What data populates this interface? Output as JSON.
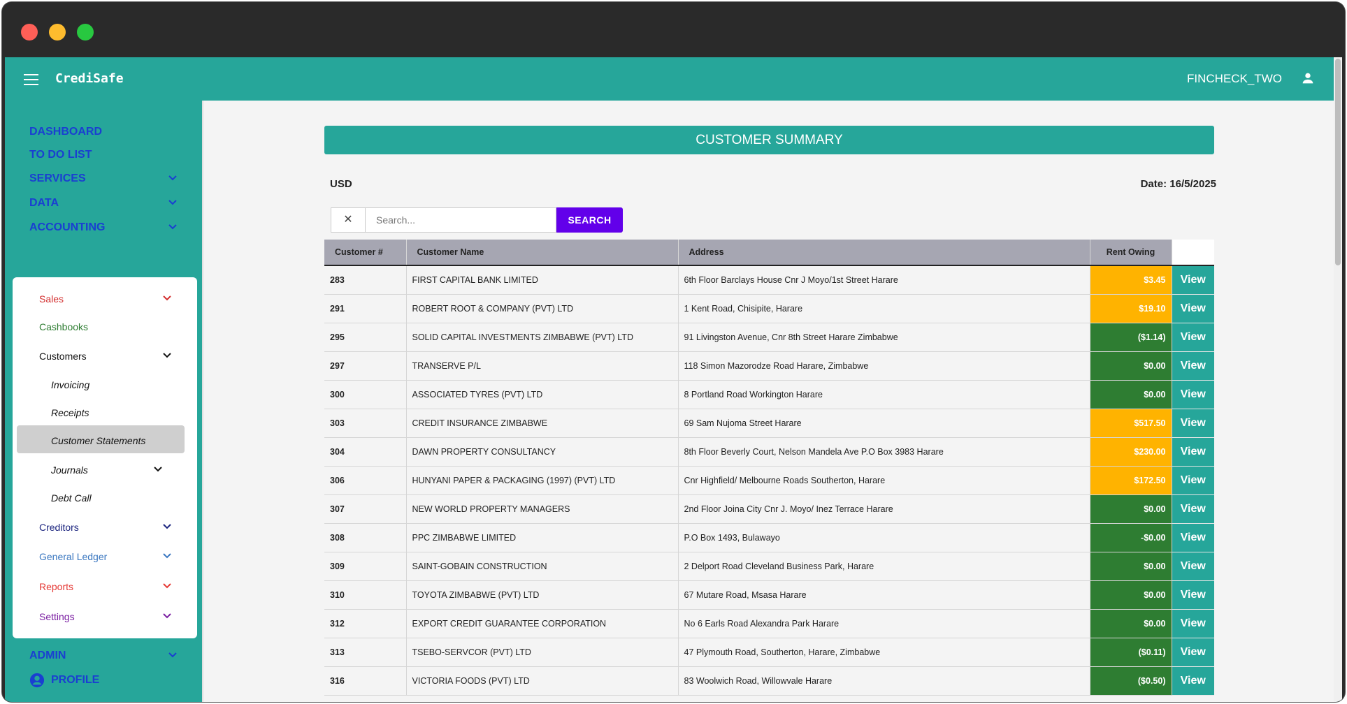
{
  "app": {
    "brand": "CrediSafe",
    "user": "FINCHECK_TWO"
  },
  "sidebar": {
    "top_items": [
      {
        "label": "DASHBOARD"
      },
      {
        "label": "TO DO LIST"
      },
      {
        "label": "SERVICES"
      },
      {
        "label": "DATA"
      },
      {
        "label": "ACCOUNTING"
      }
    ],
    "accounting_items": [
      {
        "label": "Sales",
        "color": "#d32f2f"
      },
      {
        "label": "Cashbooks",
        "color": "#2e7d32"
      },
      {
        "label": "Customers",
        "color": "#111111"
      },
      {
        "label": "Creditors",
        "color": "#1a237e"
      },
      {
        "label": "General Ledger",
        "color": "#3a77c0"
      },
      {
        "label": "Reports",
        "color": "#e53935"
      },
      {
        "label": "Settings",
        "color": "#7b1fa2"
      }
    ],
    "customer_items": [
      {
        "label": "Invoicing"
      },
      {
        "label": "Receipts"
      },
      {
        "label": "Customer Statements",
        "active": true
      },
      {
        "label": "Journals"
      },
      {
        "label": "Debt Call"
      }
    ],
    "bottom_items": [
      {
        "label": "ADMIN"
      },
      {
        "label": "PROFILE"
      }
    ]
  },
  "main": {
    "title": "CUSTOMER SUMMARY",
    "currency": "USD",
    "date": "Date: 16/5/2025",
    "search": {
      "clear": "✕",
      "placeholder": "Search...",
      "button": "SEARCH"
    },
    "columns": [
      "Customer #",
      "Customer Name",
      "Address",
      "Rent Owing"
    ],
    "view_label": "View",
    "rows": [
      {
        "num": "283",
        "name": "FIRST CAPITAL BANK LIMITED",
        "address": "6th Floor Barclays House Cnr J Moyo/1st Street Harare",
        "owing": "$3.45",
        "status": "orange"
      },
      {
        "num": "291",
        "name": "ROBERT ROOT & COMPANY (PVT) LTD",
        "address": "1 Kent Road, Chisipite, Harare",
        "owing": "$19.10",
        "status": "orange"
      },
      {
        "num": "295",
        "name": "SOLID CAPITAL INVESTMENTS ZIMBABWE (PVT) LTD",
        "address": "91 Livingston Avenue, Cnr 8th Street Harare Zimbabwe",
        "owing": "($1.14)",
        "status": "green"
      },
      {
        "num": "297",
        "name": "TRANSERVE P/L",
        "address": "118 Simon Mazorodze Road Harare, Zimbabwe",
        "owing": "$0.00",
        "status": "green"
      },
      {
        "num": "300",
        "name": "ASSOCIATED TYRES (PVT) LTD",
        "address": "8 Portland Road Workington Harare",
        "owing": "$0.00",
        "status": "green"
      },
      {
        "num": "303",
        "name": "CREDIT INSURANCE ZIMBABWE",
        "address": "69 Sam Nujoma Street Harare",
        "owing": "$517.50",
        "status": "orange"
      },
      {
        "num": "304",
        "name": "DAWN PROPERTY CONSULTANCY",
        "address": "8th Floor Beverly Court, Nelson Mandela Ave P.O Box 3983 Harare",
        "owing": "$230.00",
        "status": "orange"
      },
      {
        "num": "306",
        "name": "HUNYANI PAPER & PACKAGING (1997) (PVT) LTD",
        "address": "Cnr Highfield/ Melbourne Roads Southerton, Harare",
        "owing": "$172.50",
        "status": "orange"
      },
      {
        "num": "307",
        "name": "NEW WORLD PROPERTY MANAGERS",
        "address": "2nd Floor Joina City Cnr J. Moyo/ Inez Terrace Harare",
        "owing": "$0.00",
        "status": "green"
      },
      {
        "num": "308",
        "name": "PPC ZIMBABWE LIMITED",
        "address": "P.O Box 1493, Bulawayo",
        "owing": "-$0.00",
        "status": "green"
      },
      {
        "num": "309",
        "name": "SAINT-GOBAIN CONSTRUCTION",
        "address": "2 Delport Road Cleveland Business Park, Harare",
        "owing": "$0.00",
        "status": "green"
      },
      {
        "num": "310",
        "name": "TOYOTA ZIMBABWE (PVT) LTD",
        "address": "67 Mutare Road, Msasa Harare",
        "owing": "$0.00",
        "status": "green"
      },
      {
        "num": "312",
        "name": "EXPORT CREDIT GUARANTEE CORPORATION",
        "address": "No 6 Earls Road Alexandra Park Harare",
        "owing": "$0.00",
        "status": "green"
      },
      {
        "num": "313",
        "name": "TSEBO-SERVCOR (PVT) LTD",
        "address": "47 Plymouth Road, Southerton, Harare, Zimbabwe",
        "owing": "($0.11)",
        "status": "green"
      },
      {
        "num": "316",
        "name": "VICTORIA FOODS (PVT) LTD",
        "address": "83 Woolwich Road, Willowvale Harare",
        "owing": "($0.50)",
        "status": "green"
      }
    ]
  }
}
